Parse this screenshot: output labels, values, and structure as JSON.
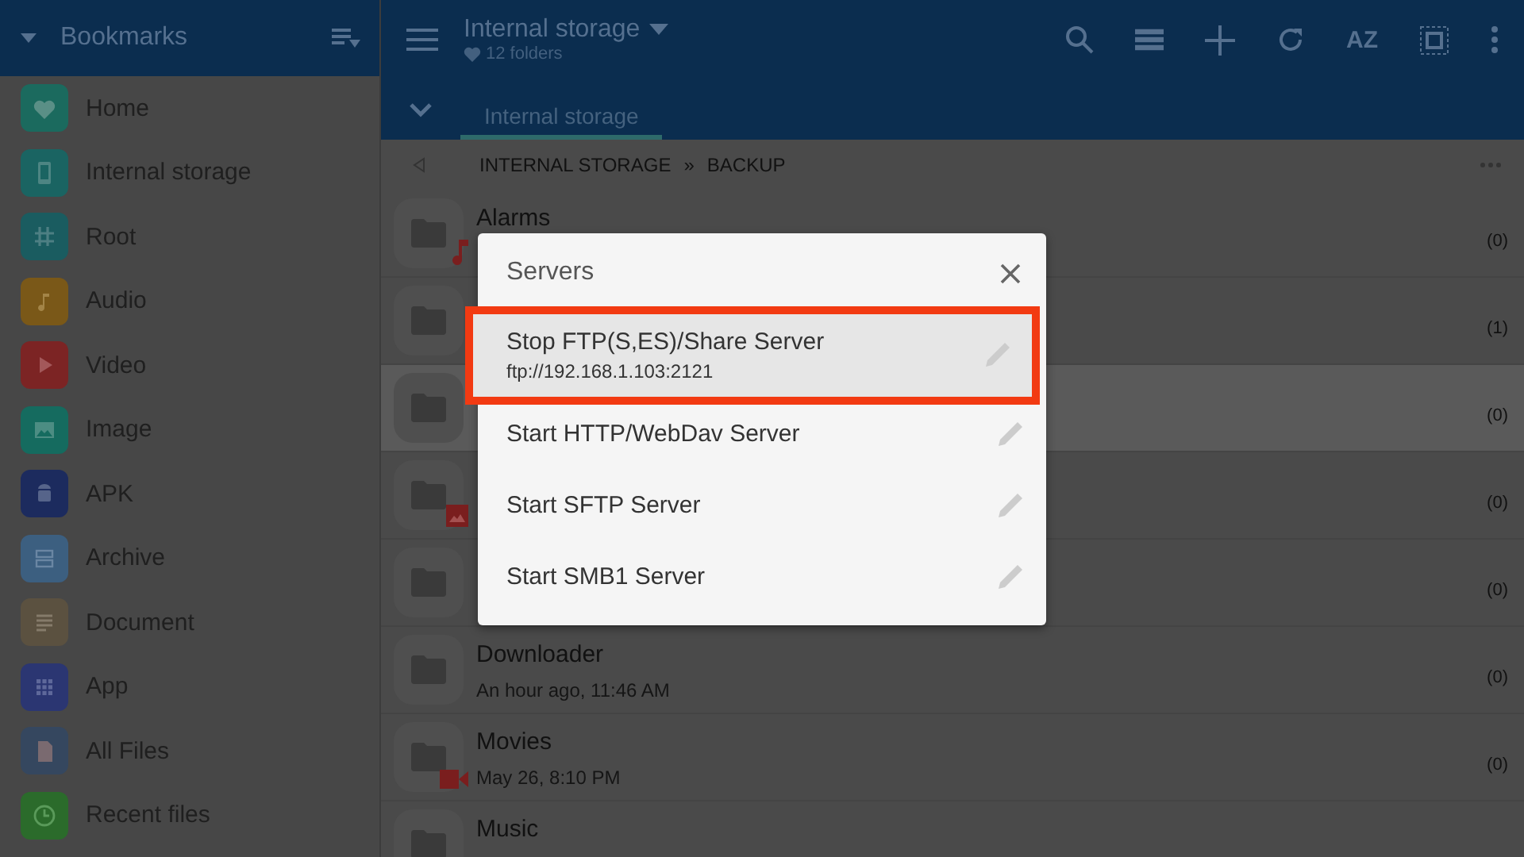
{
  "sidebar": {
    "title": "Bookmarks",
    "items": [
      {
        "label": "Home",
        "color": "#1b6a5e"
      },
      {
        "label": "Internal storage",
        "color": "#1a6462"
      },
      {
        "label": "Root",
        "color": "#1a5c60"
      },
      {
        "label": "Audio",
        "color": "#7a5818"
      },
      {
        "label": "Video",
        "color": "#7c2424"
      },
      {
        "label": "Image",
        "color": "#156b5f"
      },
      {
        "label": "APK",
        "color": "#1c2b5e"
      },
      {
        "label": "Archive",
        "color": "#3c5f80"
      },
      {
        "label": "Document",
        "color": "#5b5140"
      },
      {
        "label": "App",
        "color": "#2b3672"
      },
      {
        "label": "All Files",
        "color": "#35475f"
      },
      {
        "label": "Recent files",
        "color": "#2b6b2b"
      }
    ]
  },
  "header": {
    "title": "Internal storage",
    "subtitle": "12 folders",
    "toolbar_az": "AZ"
  },
  "tabs": [
    {
      "label": "Internal storage",
      "selected": true
    }
  ],
  "breadcrumb": {
    "parts": [
      "INTERNAL STORAGE",
      "BACKUP"
    ],
    "separator": "»"
  },
  "folders": [
    {
      "name": "Alarms",
      "count": "(0)",
      "kind": "music",
      "selected": false
    },
    {
      "count": "(1)",
      "kind": "plain",
      "selected": false
    },
    {
      "count": "(0)",
      "kind": "plain",
      "selected": true
    },
    {
      "count": "(0)",
      "kind": "image",
      "selected": false
    },
    {
      "count": "(0)",
      "kind": "plain",
      "selected": false
    },
    {
      "name": "Downloader",
      "date": "An hour ago, 11:46 AM",
      "count": "(0)",
      "kind": "plain",
      "selected": false
    },
    {
      "name": "Movies",
      "date": "May 26, 8:10 PM",
      "count": "(0)",
      "kind": "video",
      "selected": false
    },
    {
      "name": "Music",
      "kind": "plain",
      "selected": false
    }
  ],
  "dialog": {
    "title": "Servers",
    "items": [
      {
        "label": "Stop FTP(S,ES)/Share Server",
        "detail": "ftp://192.168.1.103:2121",
        "selected": true
      },
      {
        "label": "Start HTTP/WebDav Server",
        "selected": false
      },
      {
        "label": "Start SFTP Server",
        "selected": false
      },
      {
        "label": "Start SMB1 Server",
        "selected": false
      }
    ]
  }
}
